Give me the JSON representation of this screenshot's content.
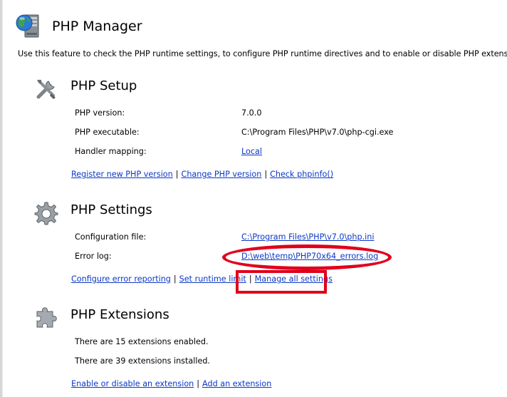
{
  "header": {
    "title": "PHP Manager",
    "description": "Use this feature to check the PHP runtime settings, to configure PHP runtime directives and to enable or disable PHP extensions."
  },
  "setup": {
    "title": "PHP Setup",
    "rows": [
      {
        "label": "PHP version:",
        "value": "7.0.0"
      },
      {
        "label": "PHP executable:",
        "value": "C:\\Program Files\\PHP\\v7.0\\php-cgi.exe"
      },
      {
        "label": "Handler mapping:",
        "value": "Local"
      }
    ],
    "actions": [
      "Register new PHP version",
      "Change PHP version",
      "Check phpinfo()"
    ]
  },
  "settings": {
    "title": "PHP Settings",
    "rows": [
      {
        "label": "Configuration file:",
        "value": "C:\\Program Files\\PHP\\v7.0\\php.ini"
      },
      {
        "label": "Error log:",
        "value": "D:\\web\\temp\\PHP70x64_errors.log"
      }
    ],
    "actions": [
      "Configure error reporting",
      "Set runtime limit",
      "Manage all settings"
    ]
  },
  "extensions": {
    "title": "PHP Extensions",
    "enabled_text": "There are 15 extensions enabled.",
    "installed_text": "There are 39 extensions installed.",
    "actions": [
      "Enable or disable an extension",
      "Add an extension"
    ]
  },
  "colors": {
    "link": "#0b38c6",
    "annotation": "#e0001b"
  },
  "icons": {
    "page": "globe-server-icon",
    "setup": "tools-icon",
    "settings": "gear-icon",
    "extensions": "puzzle-icon"
  }
}
